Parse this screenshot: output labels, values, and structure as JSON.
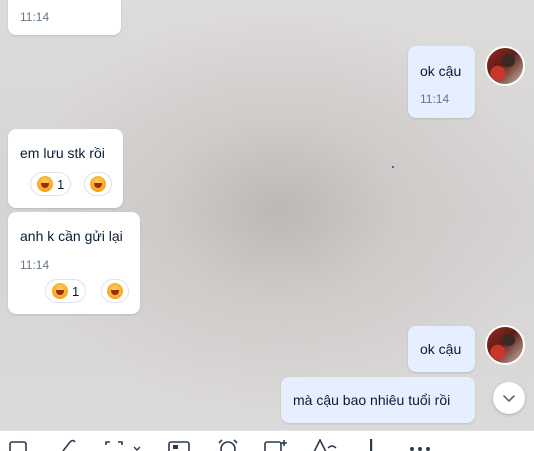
{
  "messages": [
    {
      "side": "theirs",
      "time": "11:14"
    },
    {
      "side": "mine",
      "text": "ok cậu",
      "time": "11:14"
    },
    {
      "side": "theirs",
      "text": "em lưu stk rồi",
      "reaction_count": "1"
    },
    {
      "side": "theirs",
      "text": "anh k cần gửi lại",
      "time": "11:14",
      "reaction_count": "1"
    },
    {
      "side": "mine",
      "text": "ok cậu"
    },
    {
      "side": "mine",
      "text": "mà cậu bao nhiêu tuổi rồi"
    }
  ],
  "reaction_emoji": "laughing-face",
  "colors": {
    "my_bubble": "#e5efff",
    "their_bubble": "#ffffff",
    "text": "#081c36",
    "time": "#66768c"
  },
  "toolbar_icons": [
    "sticker-icon",
    "attach-icon",
    "screenshot-icon",
    "card-icon",
    "alarm-icon",
    "task-icon",
    "format-icon",
    "urgent-icon",
    "more-icon"
  ]
}
